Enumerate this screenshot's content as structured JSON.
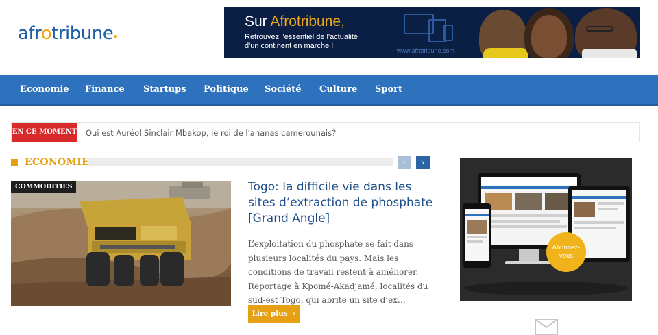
{
  "header": {
    "logo_a": "afr",
    "logo_o": "o",
    "logo_rest": "tribune",
    "banner": {
      "title_prefix": "Sur ",
      "title_brand": "Afrotribune,",
      "line1": "Retrouvez l'essentiel de l'actualité",
      "line2": "d'un continent en marche !",
      "url": "www.afrotribune.com"
    }
  },
  "nav": {
    "items": [
      "Economie",
      "Finance",
      "Startups",
      "Politique",
      "Société",
      "Culture",
      "Sport"
    ]
  },
  "ticker": {
    "label": "EN CE MOMENT",
    "headline": "Qui est Auréol Sinclair Mbakop, le roi de l'ananas camerounais?"
  },
  "section": {
    "title": "ECONOMIE",
    "prev_icon": "chevron-left-icon",
    "next_icon": "chevron-right-icon"
  },
  "article": {
    "category": "COMMODITIES",
    "title": "Togo: la difficile vie dans les sites d’extraction de phosphate [Grand Angle]",
    "excerpt": "L’exploitation du phosphate se fait dans plusieurs localités du pays. Mais les conditions de travail restent à améliorer. Reportage à Kpomé-Akadjamé, localités du sud-est Togo, qui abrite un site d’ex…",
    "read_more": "Lire plus",
    "read_more_icon": "chevron-right-icon"
  },
  "ad": {
    "subscribe_line1": "Abonnez-",
    "subscribe_line2": "vous"
  },
  "colors": {
    "brand_blue": "#2e72bd",
    "accent_orange": "#e5a013",
    "ticker_red": "#d82a2a",
    "banner_navy": "#0b1f44"
  }
}
